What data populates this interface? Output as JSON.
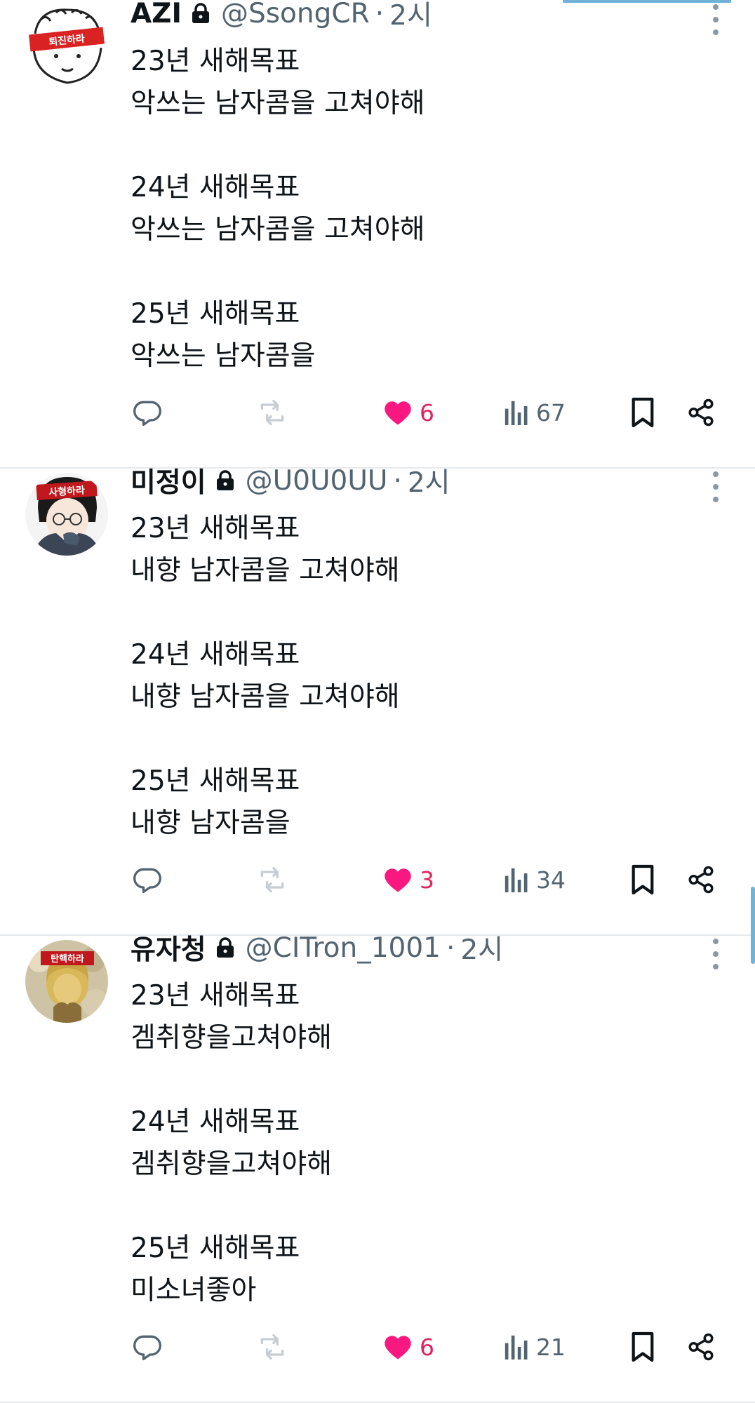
{
  "accent_color": "#6fb3d9",
  "like_color": "#f91880",
  "muted_color": "#536471",
  "tweets": [
    {
      "avatar_text": "퇴진하라",
      "name": "AZI",
      "handle": "@SsongCR",
      "separator": "·",
      "time": "2시",
      "body": "23년 새해목표\n악쓰는 남자콤을 고쳐야해\n\n24년 새해목표\n악쓰는 남자콤을 고쳐야해\n\n25년 새해목표\n악쓰는 남자콤을",
      "likes": "6",
      "views": "67"
    },
    {
      "avatar_text": "사형하라",
      "name": "미정이",
      "handle": "@U0U0UU",
      "separator": "·",
      "time": "2시",
      "body": "23년 새해목표\n내향 남자콤을 고쳐야해\n\n24년 새해목표\n내향 남자콤을 고쳐야해\n\n25년 새해목표\n내향 남자콤을",
      "likes": "3",
      "views": "34"
    },
    {
      "avatar_text": "탄핵하라",
      "name": "유자청",
      "handle": "@CITron_1001",
      "separator": "·",
      "time": "2시",
      "body": "23년 새해목표\n겜취향을고쳐야해\n\n24년 새해목표\n겜취향을고쳐야해\n\n25년 새해목표\n미소녀좋아",
      "likes": "6",
      "views": "21"
    }
  ]
}
